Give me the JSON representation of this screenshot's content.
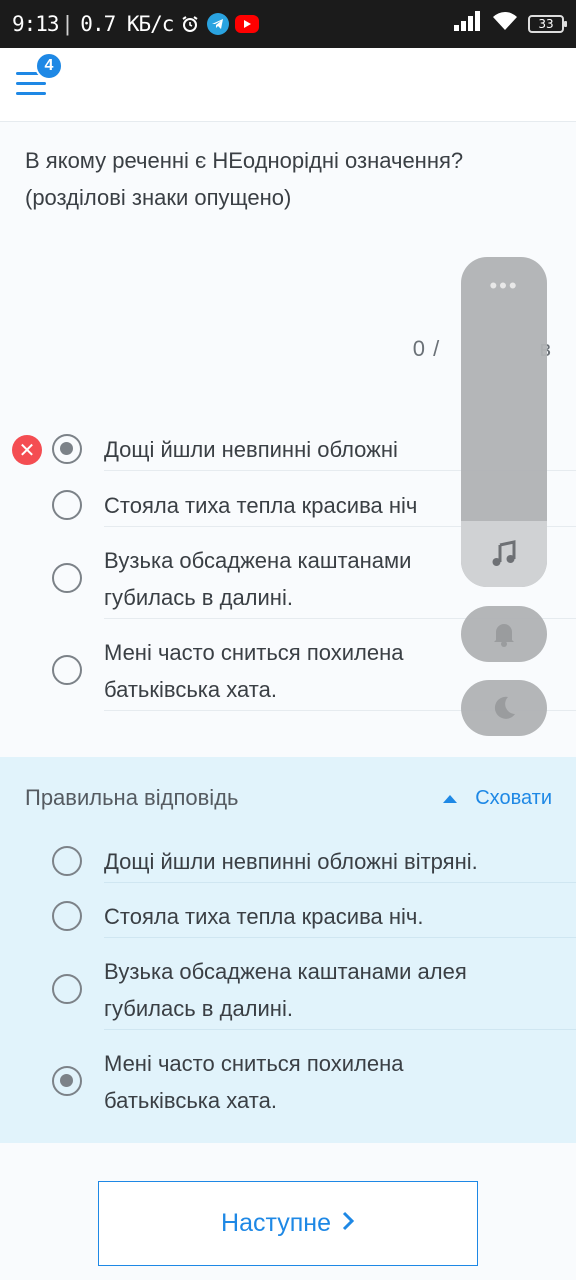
{
  "status_bar": {
    "time": "9:13",
    "net_speed": "0.7 КБ/с",
    "battery": "33"
  },
  "header": {
    "menu_badge": "4"
  },
  "question": {
    "text": "В якому реченні є НЕоднорідні означення? (розділові знаки опущено)",
    "score": "0 /",
    "score_tail": "в"
  },
  "options": [
    {
      "text": "Дощі йшли невпинні  обложні",
      "selected": true,
      "wrong": true
    },
    {
      "text": "Стояла тиха  тепла  красива ніч",
      "selected": false
    },
    {
      "text": "Вузька обсаджена каштанами",
      "line2": "губилась в далині.",
      "selected": false
    },
    {
      "text": "Мені часто сниться похилена",
      "line2": "батьківська хата.",
      "selected": false
    }
  ],
  "correct_answer": {
    "title": "Правильна відповідь",
    "hide_label": "Сховати",
    "options": [
      {
        "text": "Дощі йшли невпинні  обложні  вітряні.",
        "selected": false
      },
      {
        "text": "Стояла тиха  тепла  красива ніч.",
        "selected": false
      },
      {
        "text": "Вузька обсаджена каштанами алея",
        "line2": "губилась в далині.",
        "selected": false
      },
      {
        "text": "Мені часто сниться похилена",
        "line2": "батьківська хата.",
        "selected": true
      }
    ]
  },
  "side_panel": {
    "dots": "•••",
    "icons": [
      "music-note-icon",
      "bell-icon",
      "moon-icon"
    ]
  },
  "next_button": {
    "label": "Наступне"
  },
  "colors": {
    "accent": "#1e88e5",
    "error": "#f44d52",
    "answer_bg": "#e1f3fb"
  }
}
